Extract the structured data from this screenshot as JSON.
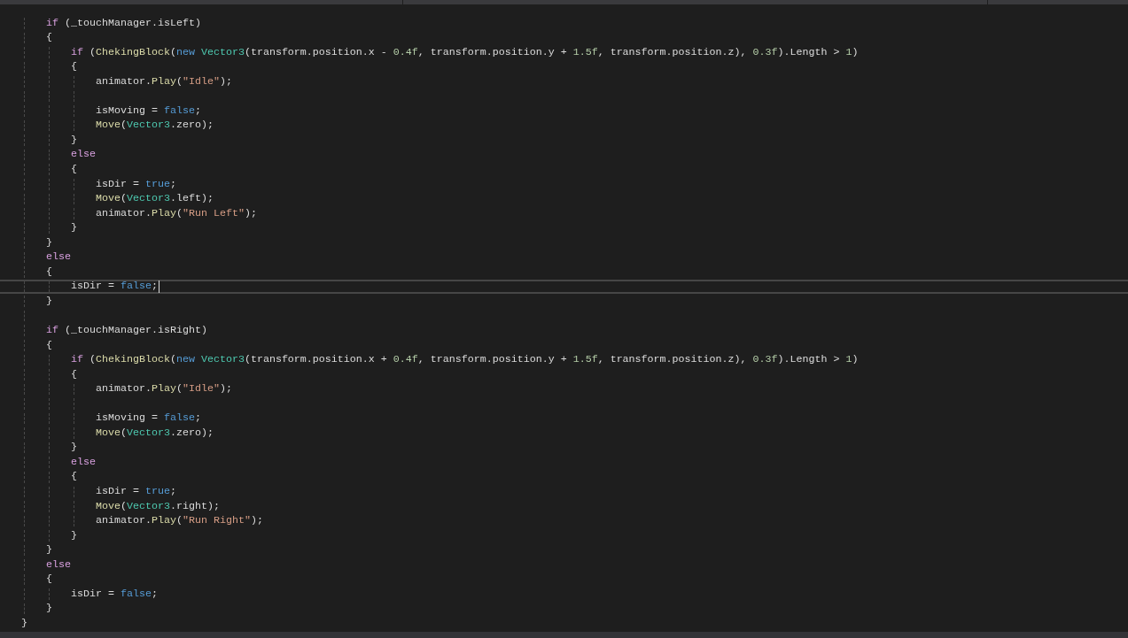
{
  "editor": {
    "lines": [
      {
        "current": false,
        "tokens": [
          {
            "kind": "keyword",
            "text": "if"
          },
          {
            "kind": "plain",
            "text": " (_touchManager.isLeft)"
          }
        ]
      },
      {
        "current": false,
        "tokens": [
          {
            "kind": "plain",
            "text": "{"
          }
        ],
        "children": [
          {
            "current": false,
            "tokens": [
              {
                "kind": "keyword",
                "text": "if"
              },
              {
                "kind": "plain",
                "text": " ("
              },
              {
                "kind": "method",
                "text": "ChekingBlock"
              },
              {
                "kind": "plain",
                "text": "("
              },
              {
                "kind": "literal",
                "text": "new "
              },
              {
                "kind": "type",
                "text": "Vector3"
              },
              {
                "kind": "plain",
                "text": "(transform.position.x - "
              },
              {
                "kind": "number",
                "text": "0.4f"
              },
              {
                "kind": "plain",
                "text": ", transform.position.y + "
              },
              {
                "kind": "number",
                "text": "1.5f"
              },
              {
                "kind": "plain",
                "text": ", transform.position.z), "
              },
              {
                "kind": "number",
                "text": "0.3f"
              },
              {
                "kind": "plain",
                "text": ").Length > "
              },
              {
                "kind": "number",
                "text": "1"
              },
              {
                "kind": "plain",
                "text": ")"
              }
            ]
          },
          {
            "current": false,
            "tokens": [
              {
                "kind": "plain",
                "text": "{"
              }
            ],
            "children": [
              {
                "current": false,
                "tokens": [
                  {
                    "kind": "plain",
                    "text": "animator."
                  },
                  {
                    "kind": "method",
                    "text": "Play"
                  },
                  {
                    "kind": "plain",
                    "text": "("
                  },
                  {
                    "kind": "string",
                    "text": "\"Idle\""
                  },
                  {
                    "kind": "plain",
                    "text": ");"
                  }
                ]
              },
              {
                "current": false
              },
              {
                "current": false,
                "tokens": [
                  {
                    "kind": "plain",
                    "text": "isMoving = "
                  },
                  {
                    "kind": "literal",
                    "text": "false"
                  },
                  {
                    "kind": "plain",
                    "text": ";"
                  }
                ]
              },
              {
                "current": false,
                "tokens": [
                  {
                    "kind": "method",
                    "text": "Move"
                  },
                  {
                    "kind": "plain",
                    "text": "("
                  },
                  {
                    "kind": "type",
                    "text": "Vector3"
                  },
                  {
                    "kind": "plain",
                    "text": ".zero);"
                  }
                ]
              }
            ]
          },
          {
            "current": false,
            "tokens": [
              {
                "kind": "plain",
                "text": "}"
              }
            ]
          },
          {
            "current": false,
            "tokens": [
              {
                "kind": "keyword",
                "text": "else"
              }
            ]
          },
          {
            "current": false,
            "tokens": [
              {
                "kind": "plain",
                "text": "{"
              }
            ],
            "children": [
              {
                "current": false,
                "tokens": [
                  {
                    "kind": "plain",
                    "text": "isDir = "
                  },
                  {
                    "kind": "literal",
                    "text": "true"
                  },
                  {
                    "kind": "plain",
                    "text": ";"
                  }
                ]
              },
              {
                "current": false,
                "tokens": [
                  {
                    "kind": "method",
                    "text": "Move"
                  },
                  {
                    "kind": "plain",
                    "text": "("
                  },
                  {
                    "kind": "type",
                    "text": "Vector3"
                  },
                  {
                    "kind": "plain",
                    "text": ".left);"
                  }
                ]
              },
              {
                "current": false,
                "tokens": [
                  {
                    "kind": "plain",
                    "text": "animator."
                  },
                  {
                    "kind": "method",
                    "text": "Play"
                  },
                  {
                    "kind": "plain",
                    "text": "("
                  },
                  {
                    "kind": "string",
                    "text": "\"Run Left\""
                  },
                  {
                    "kind": "plain",
                    "text": ");"
                  }
                ]
              }
            ]
          },
          {
            "current": false,
            "tokens": [
              {
                "kind": "plain",
                "text": "}"
              }
            ]
          }
        ]
      },
      {
        "current": false,
        "tokens": [
          {
            "kind": "plain",
            "text": "}"
          }
        ]
      },
      {
        "current": false,
        "tokens": [
          {
            "kind": "keyword",
            "text": "else"
          }
        ]
      },
      {
        "current": false,
        "tokens": [
          {
            "kind": "plain",
            "text": "{"
          }
        ],
        "children": [
          {
            "current": true,
            "tokens": [
              {
                "kind": "plain",
                "text": "isDir = "
              },
              {
                "kind": "literal",
                "text": "false"
              },
              {
                "kind": "plain",
                "text": ";"
              }
            ]
          }
        ]
      },
      {
        "current": false,
        "tokens": [
          {
            "kind": "plain",
            "text": "}"
          }
        ]
      },
      {
        "current": false
      },
      {
        "current": false,
        "tokens": [
          {
            "kind": "keyword",
            "text": "if"
          },
          {
            "kind": "plain",
            "text": " (_touchManager.isRight)"
          }
        ]
      },
      {
        "current": false,
        "tokens": [
          {
            "kind": "plain",
            "text": "{"
          }
        ],
        "children": [
          {
            "current": false,
            "tokens": [
              {
                "kind": "keyword",
                "text": "if"
              },
              {
                "kind": "plain",
                "text": " ("
              },
              {
                "kind": "method",
                "text": "ChekingBlock"
              },
              {
                "kind": "plain",
                "text": "("
              },
              {
                "kind": "literal",
                "text": "new "
              },
              {
                "kind": "type",
                "text": "Vector3"
              },
              {
                "kind": "plain",
                "text": "(transform.position.x + "
              },
              {
                "kind": "number",
                "text": "0.4f"
              },
              {
                "kind": "plain",
                "text": ", transform.position.y + "
              },
              {
                "kind": "number",
                "text": "1.5f"
              },
              {
                "kind": "plain",
                "text": ", transform.position.z), "
              },
              {
                "kind": "number",
                "text": "0.3f"
              },
              {
                "kind": "plain",
                "text": ").Length > "
              },
              {
                "kind": "number",
                "text": "1"
              },
              {
                "kind": "plain",
                "text": ")"
              }
            ]
          },
          {
            "current": false,
            "tokens": [
              {
                "kind": "plain",
                "text": "{"
              }
            ],
            "children": [
              {
                "current": false,
                "tokens": [
                  {
                    "kind": "plain",
                    "text": "animator."
                  },
                  {
                    "kind": "method",
                    "text": "Play"
                  },
                  {
                    "kind": "plain",
                    "text": "("
                  },
                  {
                    "kind": "string",
                    "text": "\"Idle\""
                  },
                  {
                    "kind": "plain",
                    "text": ");"
                  }
                ]
              },
              {
                "current": false
              },
              {
                "current": false,
                "tokens": [
                  {
                    "kind": "plain",
                    "text": "isMoving = "
                  },
                  {
                    "kind": "literal",
                    "text": "false"
                  },
                  {
                    "kind": "plain",
                    "text": ";"
                  }
                ]
              },
              {
                "current": false,
                "tokens": [
                  {
                    "kind": "method",
                    "text": "Move"
                  },
                  {
                    "kind": "plain",
                    "text": "("
                  },
                  {
                    "kind": "type",
                    "text": "Vector3"
                  },
                  {
                    "kind": "plain",
                    "text": ".zero);"
                  }
                ]
              }
            ]
          },
          {
            "current": false,
            "tokens": [
              {
                "kind": "plain",
                "text": "}"
              }
            ]
          },
          {
            "current": false,
            "tokens": [
              {
                "kind": "keyword",
                "text": "else"
              }
            ]
          },
          {
            "current": false,
            "tokens": [
              {
                "kind": "plain",
                "text": "{"
              }
            ],
            "children": [
              {
                "current": false,
                "tokens": [
                  {
                    "kind": "plain",
                    "text": "isDir = "
                  },
                  {
                    "kind": "literal",
                    "text": "true"
                  },
                  {
                    "kind": "plain",
                    "text": ";"
                  }
                ]
              },
              {
                "current": false,
                "tokens": [
                  {
                    "kind": "method",
                    "text": "Move"
                  },
                  {
                    "kind": "plain",
                    "text": "("
                  },
                  {
                    "kind": "type",
                    "text": "Vector3"
                  },
                  {
                    "kind": "plain",
                    "text": ".right);"
                  }
                ]
              },
              {
                "current": false,
                "tokens": [
                  {
                    "kind": "plain",
                    "text": "animator."
                  },
                  {
                    "kind": "method",
                    "text": "Play"
                  },
                  {
                    "kind": "plain",
                    "text": "("
                  },
                  {
                    "kind": "string",
                    "text": "\"Run Right\""
                  },
                  {
                    "kind": "plain",
                    "text": ");"
                  }
                ]
              }
            ]
          },
          {
            "current": false,
            "tokens": [
              {
                "kind": "plain",
                "text": "}"
              }
            ]
          }
        ]
      },
      {
        "current": false,
        "tokens": [
          {
            "kind": "plain",
            "text": "}"
          }
        ]
      },
      {
        "current": false,
        "tokens": [
          {
            "kind": "keyword",
            "text": "else"
          }
        ]
      },
      {
        "current": false,
        "tokens": [
          {
            "kind": "plain",
            "text": "{"
          }
        ],
        "children": [
          {
            "current": false,
            "tokens": [
              {
                "kind": "plain",
                "text": "isDir = "
              },
              {
                "kind": "literal",
                "text": "false"
              },
              {
                "kind": "plain",
                "text": ";"
              }
            ]
          }
        ]
      },
      {
        "current": false,
        "tokens": [
          {
            "kind": "plain",
            "text": "}"
          }
        ]
      }
    ],
    "end_line": {
      "current": false,
      "tokens": [
        {
          "kind": "plain",
          "text": "}"
        }
      ]
    }
  }
}
